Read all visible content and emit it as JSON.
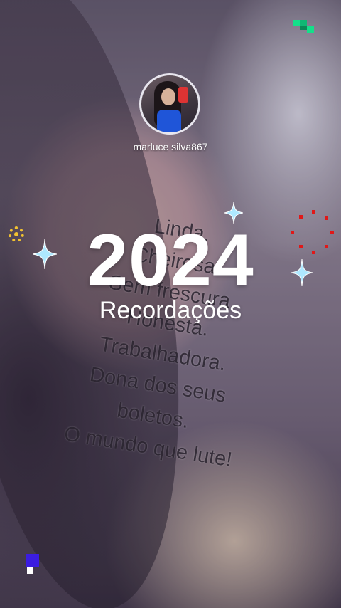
{
  "profile": {
    "username": "marluce silva867"
  },
  "title": {
    "year": "2024",
    "subtitle": "Recordações"
  },
  "caption": {
    "lines": [
      "Linda.",
      "Cheirosa.",
      "Sem frescura.",
      "Honesta.",
      "Trabalhadora.",
      "Dona dos seus",
      "boletos.",
      "O mundo que lute!"
    ]
  },
  "colors": {
    "pixel_green": "#14e08a",
    "sparkle_blue": "#aee8ff",
    "gear_yellow": "#f2c230",
    "dots_red": "#e01818",
    "square_blue": "#3b1de0"
  }
}
